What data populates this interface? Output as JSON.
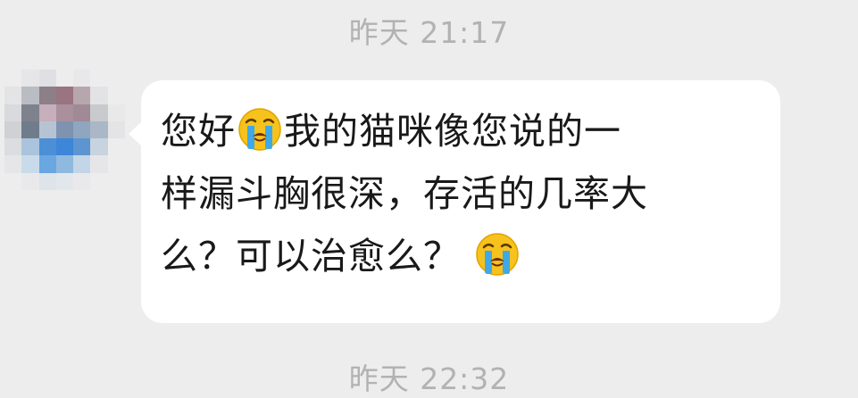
{
  "chat": {
    "timestamp_top": "昨天 21:17",
    "timestamp_bottom": "昨天 22:32",
    "message": {
      "line1_a": "您好",
      "line1_emoji": "loudly-crying-face",
      "line1_b": "我的猫咪像您说的一",
      "line2": "样漏斗胸很深，存活的几率大",
      "line3_a": "么？可以治愈么？",
      "line3_emoji": "loudly-crying-face"
    },
    "colors": {
      "background": "#ededed",
      "bubble": "#ffffff",
      "text": "#191919",
      "timestamp": "#b2b2b2"
    }
  }
}
